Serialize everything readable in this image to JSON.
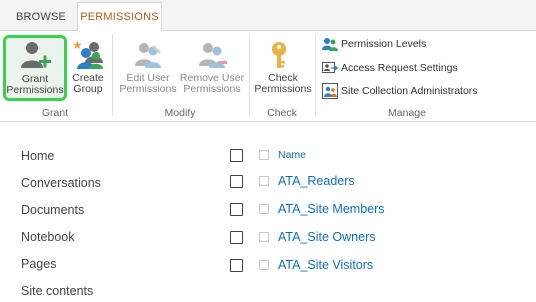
{
  "tabs": {
    "browse": "BROWSE",
    "permissions": "PERMISSIONS"
  },
  "ribbon": {
    "grant": {
      "group_label": "Grant",
      "grant_permissions": {
        "line1": "Grant",
        "line2": "Permissions"
      },
      "create_group": {
        "line1": "Create",
        "line2": "Group"
      }
    },
    "modify": {
      "group_label": "Modify",
      "edit_user_permissions": {
        "line1": "Edit User",
        "line2": "Permissions"
      },
      "remove_user_permissions": {
        "line1": "Remove User",
        "line2": "Permissions"
      }
    },
    "check": {
      "group_label": "Check",
      "check_permissions": {
        "line1": "Check",
        "line2": "Permissions"
      }
    },
    "manage": {
      "group_label": "Manage",
      "permission_levels": "Permission Levels",
      "access_request_settings": "Access Request Settings",
      "site_collection_administrators": "Site Collection Administrators"
    }
  },
  "leftnav": {
    "items": [
      "Home",
      "Conversations",
      "Documents",
      "Notebook",
      "Pages",
      "Site contents"
    ]
  },
  "list": {
    "header_name": "Name",
    "rows": [
      "ATA_Readers",
      "ATA_Site Members",
      "ATA_Site Owners",
      "ATA_Site Visitors"
    ]
  },
  "colors": {
    "accent_tab": "#b05a12",
    "link": "#106ebe",
    "highlight_border": "#3bd14b"
  }
}
